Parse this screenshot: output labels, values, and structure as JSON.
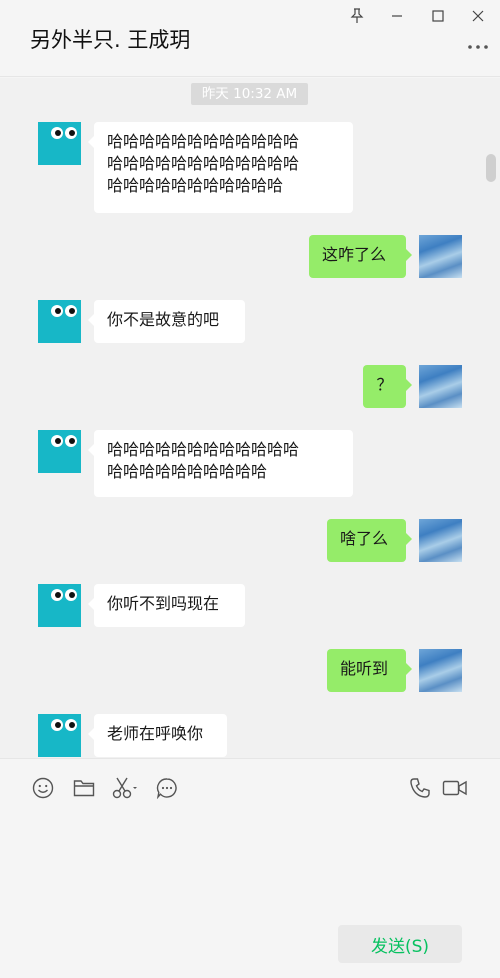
{
  "window": {
    "title": "另外半只. 王成玥",
    "controls": [
      "pin-icon",
      "minimize-icon",
      "maximize-icon",
      "close-icon"
    ],
    "more_icon": "more-icon"
  },
  "chat": {
    "timestamp": "昨天 10:32 AM",
    "messages": [
      {
        "side": "in",
        "text": "哈哈哈哈哈哈哈哈哈哈哈哈\n哈哈哈哈哈哈哈哈哈哈哈哈\n哈哈哈哈哈哈哈哈哈哈哈"
      },
      {
        "side": "out",
        "text": "这咋了么"
      },
      {
        "side": "in",
        "text": "你不是故意的吧"
      },
      {
        "side": "out",
        "text": "？"
      },
      {
        "side": "in",
        "text": "哈哈哈哈哈哈哈哈哈哈哈哈\n哈哈哈哈哈哈哈哈哈哈"
      },
      {
        "side": "out",
        "text": "啥了么"
      },
      {
        "side": "in",
        "text": "你听不到吗现在"
      },
      {
        "side": "out",
        "text": "能听到"
      },
      {
        "side": "in",
        "text": "老师在呼唤你"
      }
    ]
  },
  "toolbar": {
    "icons": [
      "emoji-icon",
      "folder-icon",
      "scissors-icon",
      "chat-history-icon",
      "phone-icon",
      "video-icon"
    ]
  },
  "input": {
    "value": "",
    "send_label": "发送(S)"
  },
  "colors": {
    "outgoing_bubble": "#95ec69",
    "incoming_bubble": "#ffffff",
    "avatar_contact": "#17b7c7",
    "send_text": "#07c160"
  }
}
